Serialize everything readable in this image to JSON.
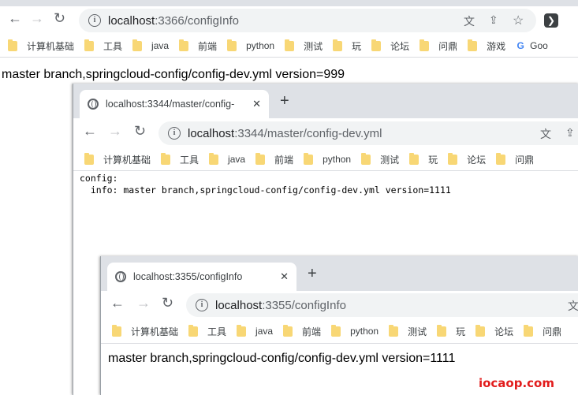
{
  "windows": {
    "back": {
      "url_host": "localhost",
      "url_path": ":3366/configInfo",
      "body_text": "master branch,springcloud-config/config-dev.yml version=999"
    },
    "middle": {
      "tab_title": "localhost:3344/master/config-",
      "url_host": "localhost",
      "url_path": ":3344/master/config-dev.yml",
      "yaml_line1": "config:",
      "yaml_line2": "  info: master branch,springcloud-config/config-dev.yml version=1111"
    },
    "front": {
      "tab_title": "localhost:3355/configInfo",
      "url_host": "localhost",
      "url_path": ":3355/configInfo",
      "body_text": "master branch,springcloud-config/config-dev.yml version=1111"
    }
  },
  "bookmarks": [
    "计算机基础",
    "工具",
    "java",
    "前端",
    "python",
    "测试",
    "玩",
    "论坛",
    "问鼎",
    "游戏",
    "Goo"
  ],
  "icons": {
    "back": "←",
    "forward": "→",
    "reload": "↻",
    "close": "✕",
    "new_tab": "+",
    "translate": "文",
    "share": "⇪",
    "star": "☆",
    "extension": "❯",
    "info": "i",
    "google": "G"
  },
  "watermark": "iocaop.com",
  "colors": {
    "tab_strip": "#dee1e6",
    "folder": "#f8d775",
    "watermark": "#e21c1c"
  }
}
